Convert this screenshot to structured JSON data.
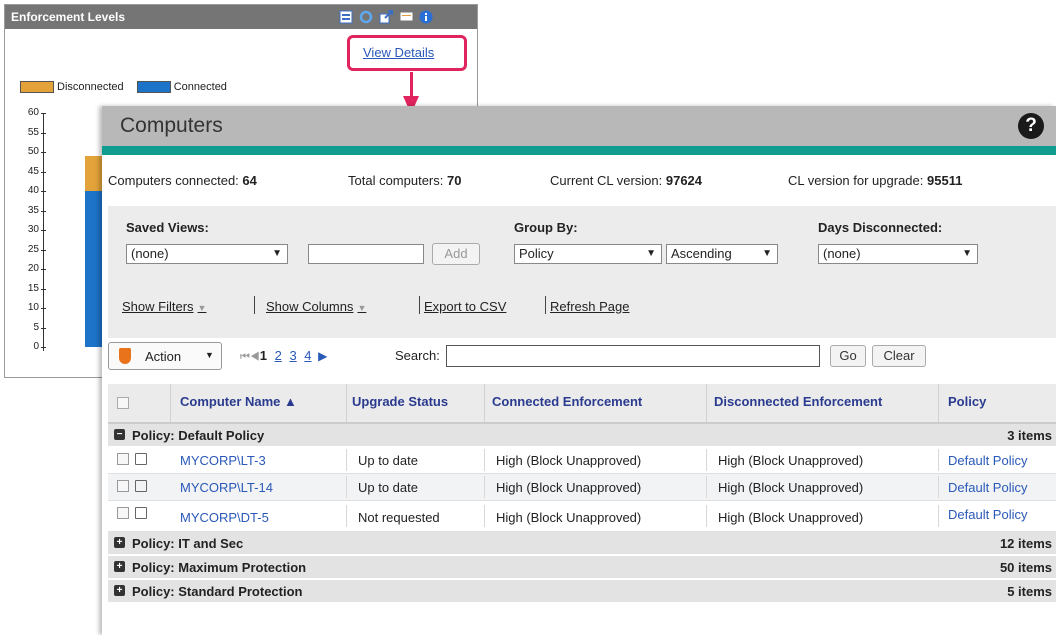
{
  "widget": {
    "title": "Enforcement Levels",
    "view_details": "View Details",
    "header_icons": [
      "grid-icon",
      "refresh-icon",
      "popout-icon",
      "comment-icon",
      "info-icon"
    ],
    "legend": [
      {
        "label": "Disconnected",
        "color": "#e3a33a"
      },
      {
        "label": "Connected",
        "color": "#1c73c8"
      }
    ],
    "y_axis_labels": [
      "60",
      "55",
      "50",
      "45",
      "40",
      "35",
      "30",
      "25",
      "20",
      "15",
      "10",
      "5",
      "0"
    ]
  },
  "chart_data": {
    "type": "bar",
    "title": "Enforcement Levels",
    "xlabel": "",
    "ylabel": "",
    "ylim": [
      0,
      60
    ],
    "categories": [
      ""
    ],
    "series": [
      {
        "name": "Connected",
        "values": [
          40
        ]
      },
      {
        "name": "Disconnected",
        "values": [
          9
        ]
      }
    ]
  },
  "panel": {
    "title": "Computers",
    "help": "?",
    "stats": [
      {
        "label": "Computers connected:",
        "value": "64"
      },
      {
        "label": "Total computers:",
        "value": "70"
      },
      {
        "label": "Current CL version:",
        "value": "97624"
      },
      {
        "label": "CL version for upgrade:",
        "value": "95511"
      }
    ],
    "filters": {
      "saved_views_label": "Saved Views:",
      "saved_views_value": "(none)",
      "add_label": "Add",
      "group_by_label": "Group By:",
      "group_by_value": "Policy",
      "order_value": "Ascending",
      "days_label": "Days Disconnected:",
      "days_value": "(none)",
      "show_filters": "Show Filters",
      "show_columns": "Show Columns",
      "export_csv": "Export to CSV",
      "refresh_page": "Refresh Page"
    },
    "toolbar": {
      "action_label": "Action",
      "pager_nav": "⏮◀",
      "pages": [
        "1",
        "2",
        "3",
        "4"
      ],
      "current_page": "1",
      "next_symbol": "▶",
      "search_label": "Search:",
      "search_value": "",
      "go_label": "Go",
      "clear_label": "Clear"
    },
    "table": {
      "columns": [
        "Computer Name ▲",
        "Upgrade Status",
        "Connected Enforcement",
        "Disconnected Enforcement",
        "Policy"
      ],
      "groups": [
        {
          "label": "Policy: Default Policy",
          "count": "3 items",
          "expanded": true,
          "rows": [
            {
              "name": "MYCORP\\LT-3",
              "status": "Up to date",
              "connected": "High (Block Unapproved)",
              "disconnected": "High (Block Unapproved)",
              "policy": "Default Policy"
            },
            {
              "name": "MYCORP\\LT-14",
              "status": "Up to date",
              "connected": "High (Block Unapproved)",
              "disconnected": "High (Block Unapproved)",
              "policy": "Default Policy"
            },
            {
              "name": "MYCORP\\DT-5",
              "status": "Not requested",
              "connected": "High (Block Unapproved)",
              "disconnected": "High (Block Unapproved)",
              "policy": "Default Policy"
            }
          ]
        },
        {
          "label": "Policy: IT and Sec",
          "count": "12 items",
          "expanded": false
        },
        {
          "label": "Policy: Maximum Protection",
          "count": "50 items",
          "expanded": false
        },
        {
          "label": "Policy: Standard Protection",
          "count": "5 items",
          "expanded": false
        }
      ]
    }
  }
}
